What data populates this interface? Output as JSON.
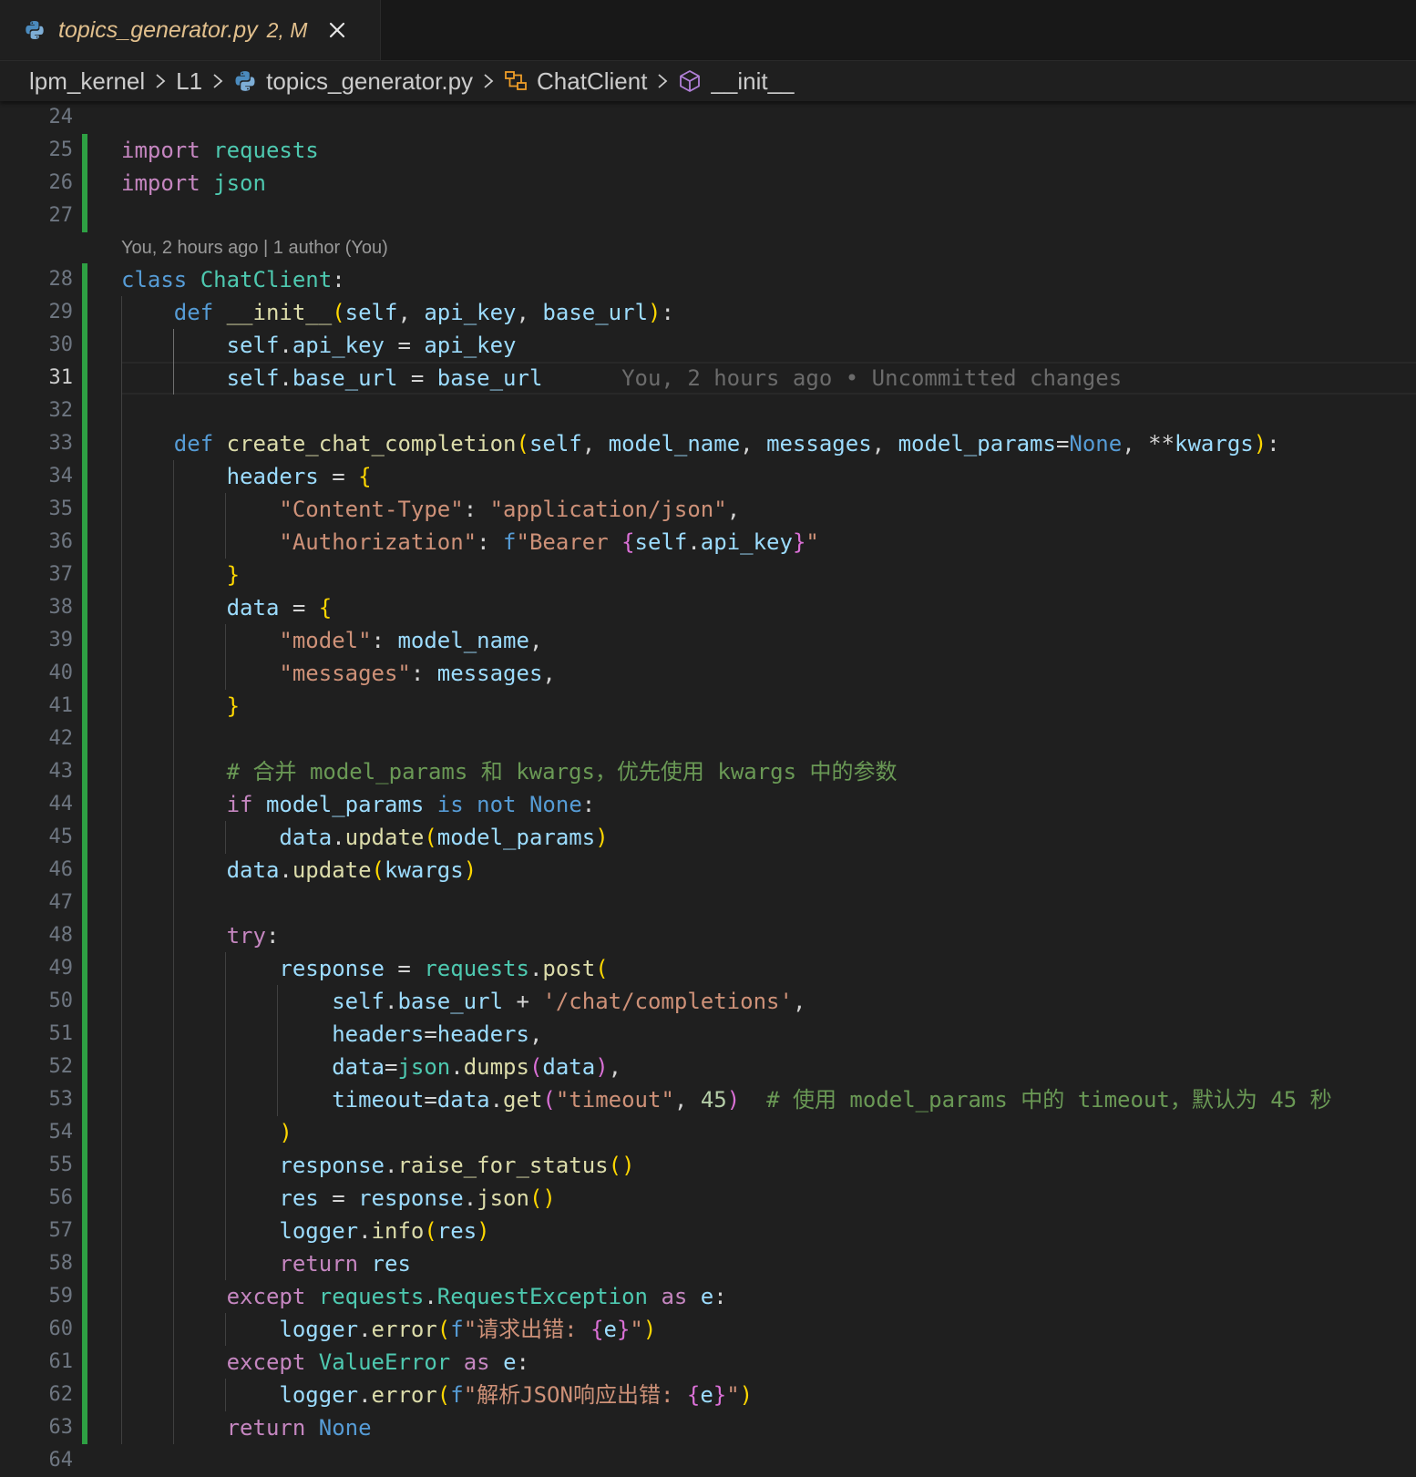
{
  "tab": {
    "filename": "topics_generator.py",
    "status": "2, M"
  },
  "breadcrumb": {
    "items": [
      "lpm_kernel",
      "L1",
      "topics_generator.py",
      "ChatClient",
      "__init__"
    ]
  },
  "editor": {
    "codelens": "You, 2 hours ago | 1 author (You)",
    "blame": "You, 2 hours ago • Uncommitted changes",
    "active_line": 31,
    "lines": [
      {
        "n": "24",
        "segs": []
      },
      {
        "n": "25",
        "segs": [
          [
            "import",
            "k"
          ],
          [
            " ",
            "p"
          ],
          [
            "requests",
            "cls"
          ]
        ]
      },
      {
        "n": "26",
        "segs": [
          [
            "import",
            "k"
          ],
          [
            " ",
            "p"
          ],
          [
            "json",
            "cls"
          ]
        ]
      },
      {
        "n": "27",
        "segs": []
      },
      {
        "n": "28",
        "segs": [
          [
            "class",
            "kd"
          ],
          [
            " ",
            "p"
          ],
          [
            "ChatClient",
            "cls"
          ],
          [
            ":",
            "p"
          ]
        ]
      },
      {
        "n": "29",
        "segs": [
          [
            "    ",
            "p"
          ],
          [
            "def",
            "kd"
          ],
          [
            " ",
            "p"
          ],
          [
            "__init__",
            "fn"
          ],
          [
            "(",
            "b1"
          ],
          [
            "self",
            "v"
          ],
          [
            ", ",
            "p"
          ],
          [
            "api_key",
            "v"
          ],
          [
            ", ",
            "p"
          ],
          [
            "base_url",
            "v"
          ],
          [
            ")",
            "b1"
          ],
          [
            ":",
            "p"
          ]
        ]
      },
      {
        "n": "30",
        "segs": [
          [
            "        ",
            "p"
          ],
          [
            "self",
            "v"
          ],
          [
            ".",
            "p"
          ],
          [
            "api_key",
            "v"
          ],
          [
            " = ",
            "p"
          ],
          [
            "api_key",
            "v"
          ]
        ]
      },
      {
        "n": "31",
        "segs": [
          [
            "        ",
            "p"
          ],
          [
            "self",
            "v"
          ],
          [
            ".",
            "p"
          ],
          [
            "base_url",
            "v"
          ],
          [
            " = ",
            "p"
          ],
          [
            "base_url",
            "v"
          ]
        ]
      },
      {
        "n": "32",
        "segs": []
      },
      {
        "n": "33",
        "segs": [
          [
            "    ",
            "p"
          ],
          [
            "def",
            "kd"
          ],
          [
            " ",
            "p"
          ],
          [
            "create_chat_completion",
            "fn"
          ],
          [
            "(",
            "b1"
          ],
          [
            "self",
            "v"
          ],
          [
            ", ",
            "p"
          ],
          [
            "model_name",
            "v"
          ],
          [
            ", ",
            "p"
          ],
          [
            "messages",
            "v"
          ],
          [
            ", ",
            "p"
          ],
          [
            "model_params",
            "v"
          ],
          [
            "=",
            "p"
          ],
          [
            "None",
            "kd"
          ],
          [
            ", ",
            "p"
          ],
          [
            "**",
            "p"
          ],
          [
            "kwargs",
            "v"
          ],
          [
            ")",
            "b1"
          ],
          [
            ":",
            "p"
          ]
        ]
      },
      {
        "n": "34",
        "segs": [
          [
            "        ",
            "p"
          ],
          [
            "headers",
            "v"
          ],
          [
            " = ",
            "p"
          ],
          [
            "{",
            "b1"
          ]
        ]
      },
      {
        "n": "35",
        "segs": [
          [
            "            ",
            "p"
          ],
          [
            "\"Content-Type\"",
            "s"
          ],
          [
            ": ",
            "p"
          ],
          [
            "\"application/json\"",
            "s"
          ],
          [
            ",",
            "p"
          ]
        ]
      },
      {
        "n": "36",
        "segs": [
          [
            "            ",
            "p"
          ],
          [
            "\"Authorization\"",
            "s"
          ],
          [
            ": ",
            "p"
          ],
          [
            "f",
            "kd"
          ],
          [
            "\"Bearer ",
            "s"
          ],
          [
            "{",
            "b2"
          ],
          [
            "self",
            "v"
          ],
          [
            ".",
            "p"
          ],
          [
            "api_key",
            "v"
          ],
          [
            "}",
            "b2"
          ],
          [
            "\"",
            "s"
          ]
        ]
      },
      {
        "n": "37",
        "segs": [
          [
            "        ",
            "p"
          ],
          [
            "}",
            "b1"
          ]
        ]
      },
      {
        "n": "38",
        "segs": [
          [
            "        ",
            "p"
          ],
          [
            "data",
            "v"
          ],
          [
            " = ",
            "p"
          ],
          [
            "{",
            "b1"
          ]
        ]
      },
      {
        "n": "39",
        "segs": [
          [
            "            ",
            "p"
          ],
          [
            "\"model\"",
            "s"
          ],
          [
            ": ",
            "p"
          ],
          [
            "model_name",
            "v"
          ],
          [
            ",",
            "p"
          ]
        ]
      },
      {
        "n": "40",
        "segs": [
          [
            "            ",
            "p"
          ],
          [
            "\"messages\"",
            "s"
          ],
          [
            ": ",
            "p"
          ],
          [
            "messages",
            "v"
          ],
          [
            ",",
            "p"
          ]
        ]
      },
      {
        "n": "41",
        "segs": [
          [
            "        ",
            "p"
          ],
          [
            "}",
            "b1"
          ]
        ]
      },
      {
        "n": "42",
        "segs": []
      },
      {
        "n": "43",
        "segs": [
          [
            "        ",
            "p"
          ],
          [
            "# 合并 model_params 和 kwargs，优先使用 kwargs 中的参数",
            "cm"
          ]
        ]
      },
      {
        "n": "44",
        "segs": [
          [
            "        ",
            "p"
          ],
          [
            "if",
            "k"
          ],
          [
            " ",
            "p"
          ],
          [
            "model_params",
            "v"
          ],
          [
            " ",
            "p"
          ],
          [
            "is",
            "kd"
          ],
          [
            " ",
            "p"
          ],
          [
            "not",
            "kd"
          ],
          [
            " ",
            "p"
          ],
          [
            "None",
            "kd"
          ],
          [
            ":",
            "p"
          ]
        ]
      },
      {
        "n": "45",
        "segs": [
          [
            "            ",
            "p"
          ],
          [
            "data",
            "v"
          ],
          [
            ".",
            "p"
          ],
          [
            "update",
            "fn"
          ],
          [
            "(",
            "b1"
          ],
          [
            "model_params",
            "v"
          ],
          [
            ")",
            "b1"
          ]
        ]
      },
      {
        "n": "46",
        "segs": [
          [
            "        ",
            "p"
          ],
          [
            "data",
            "v"
          ],
          [
            ".",
            "p"
          ],
          [
            "update",
            "fn"
          ],
          [
            "(",
            "b1"
          ],
          [
            "kwargs",
            "v"
          ],
          [
            ")",
            "b1"
          ]
        ]
      },
      {
        "n": "47",
        "segs": []
      },
      {
        "n": "48",
        "segs": [
          [
            "        ",
            "p"
          ],
          [
            "try",
            "k"
          ],
          [
            ":",
            "p"
          ]
        ]
      },
      {
        "n": "49",
        "segs": [
          [
            "            ",
            "p"
          ],
          [
            "response",
            "v"
          ],
          [
            " = ",
            "p"
          ],
          [
            "requests",
            "cls"
          ],
          [
            ".",
            "p"
          ],
          [
            "post",
            "fn"
          ],
          [
            "(",
            "b1"
          ]
        ]
      },
      {
        "n": "50",
        "segs": [
          [
            "                ",
            "p"
          ],
          [
            "self",
            "v"
          ],
          [
            ".",
            "p"
          ],
          [
            "base_url",
            "v"
          ],
          [
            " + ",
            "p"
          ],
          [
            "'/chat/completions'",
            "s"
          ],
          [
            ",",
            "p"
          ]
        ]
      },
      {
        "n": "51",
        "segs": [
          [
            "                ",
            "p"
          ],
          [
            "headers",
            "v"
          ],
          [
            "=",
            "p"
          ],
          [
            "headers",
            "v"
          ],
          [
            ",",
            "p"
          ]
        ]
      },
      {
        "n": "52",
        "segs": [
          [
            "                ",
            "p"
          ],
          [
            "data",
            "v"
          ],
          [
            "=",
            "p"
          ],
          [
            "json",
            "cls"
          ],
          [
            ".",
            "p"
          ],
          [
            "dumps",
            "fn"
          ],
          [
            "(",
            "b2"
          ],
          [
            "data",
            "v"
          ],
          [
            ")",
            "b2"
          ],
          [
            ",",
            "p"
          ]
        ]
      },
      {
        "n": "53",
        "segs": [
          [
            "                ",
            "p"
          ],
          [
            "timeout",
            "v"
          ],
          [
            "=",
            "p"
          ],
          [
            "data",
            "v"
          ],
          [
            ".",
            "p"
          ],
          [
            "get",
            "fn"
          ],
          [
            "(",
            "b2"
          ],
          [
            "\"timeout\"",
            "s"
          ],
          [
            ", ",
            "p"
          ],
          [
            "45",
            "n"
          ],
          [
            ")",
            "b2"
          ],
          [
            "  ",
            "p"
          ],
          [
            "# 使用 model_params 中的 timeout，默认为 45 秒",
            "cm"
          ]
        ]
      },
      {
        "n": "54",
        "segs": [
          [
            "            ",
            "p"
          ],
          [
            ")",
            "b1"
          ]
        ]
      },
      {
        "n": "55",
        "segs": [
          [
            "            ",
            "p"
          ],
          [
            "response",
            "v"
          ],
          [
            ".",
            "p"
          ],
          [
            "raise_for_status",
            "fn"
          ],
          [
            "()",
            "b1"
          ]
        ]
      },
      {
        "n": "56",
        "segs": [
          [
            "            ",
            "p"
          ],
          [
            "res",
            "v"
          ],
          [
            " = ",
            "p"
          ],
          [
            "response",
            "v"
          ],
          [
            ".",
            "p"
          ],
          [
            "json",
            "fn"
          ],
          [
            "()",
            "b1"
          ]
        ]
      },
      {
        "n": "57",
        "segs": [
          [
            "            ",
            "p"
          ],
          [
            "logger",
            "v"
          ],
          [
            ".",
            "p"
          ],
          [
            "info",
            "fn"
          ],
          [
            "(",
            "b1"
          ],
          [
            "res",
            "v"
          ],
          [
            ")",
            "b1"
          ]
        ]
      },
      {
        "n": "58",
        "segs": [
          [
            "            ",
            "p"
          ],
          [
            "return",
            "k"
          ],
          [
            " ",
            "p"
          ],
          [
            "res",
            "v"
          ]
        ]
      },
      {
        "n": "59",
        "segs": [
          [
            "        ",
            "p"
          ],
          [
            "except",
            "k"
          ],
          [
            " ",
            "p"
          ],
          [
            "requests",
            "cls"
          ],
          [
            ".",
            "p"
          ],
          [
            "RequestException",
            "cls"
          ],
          [
            " ",
            "p"
          ],
          [
            "as",
            "k"
          ],
          [
            " ",
            "p"
          ],
          [
            "e",
            "v"
          ],
          [
            ":",
            "p"
          ]
        ]
      },
      {
        "n": "60",
        "segs": [
          [
            "            ",
            "p"
          ],
          [
            "logger",
            "v"
          ],
          [
            ".",
            "p"
          ],
          [
            "error",
            "fn"
          ],
          [
            "(",
            "b1"
          ],
          [
            "f",
            "kd"
          ],
          [
            "\"请求出错: ",
            "s"
          ],
          [
            "{",
            "b2"
          ],
          [
            "e",
            "v"
          ],
          [
            "}",
            "b2"
          ],
          [
            "\"",
            "s"
          ],
          [
            ")",
            "b1"
          ]
        ]
      },
      {
        "n": "61",
        "segs": [
          [
            "        ",
            "p"
          ],
          [
            "except",
            "k"
          ],
          [
            " ",
            "p"
          ],
          [
            "ValueError",
            "cls"
          ],
          [
            " ",
            "p"
          ],
          [
            "as",
            "k"
          ],
          [
            " ",
            "p"
          ],
          [
            "e",
            "v"
          ],
          [
            ":",
            "p"
          ]
        ]
      },
      {
        "n": "62",
        "segs": [
          [
            "            ",
            "p"
          ],
          [
            "logger",
            "v"
          ],
          [
            ".",
            "p"
          ],
          [
            "error",
            "fn"
          ],
          [
            "(",
            "b1"
          ],
          [
            "f",
            "kd"
          ],
          [
            "\"解析JSON响应出错: ",
            "s"
          ],
          [
            "{",
            "b2"
          ],
          [
            "e",
            "v"
          ],
          [
            "}",
            "b2"
          ],
          [
            "\"",
            "s"
          ],
          [
            ")",
            "b1"
          ]
        ]
      },
      {
        "n": "63",
        "segs": [
          [
            "        ",
            "p"
          ],
          [
            "return",
            "k"
          ],
          [
            " ",
            "p"
          ],
          [
            "None",
            "kd"
          ]
        ]
      },
      {
        "n": "64",
        "segs": []
      }
    ]
  }
}
